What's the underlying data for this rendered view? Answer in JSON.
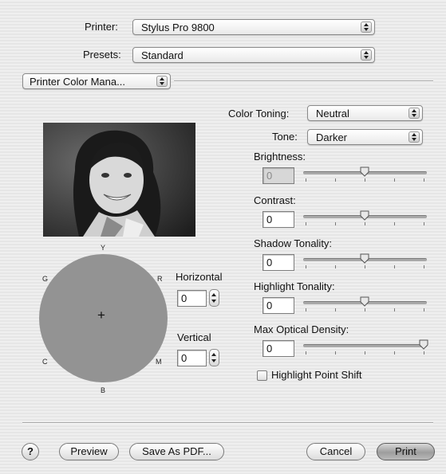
{
  "printer": {
    "label": "Printer:",
    "value": "Stylus Pro 9800"
  },
  "presets": {
    "label": "Presets:",
    "value": "Standard"
  },
  "panel": {
    "value": "Printer Color Mana..."
  },
  "color_toning": {
    "label": "Color Toning:",
    "value": "Neutral"
  },
  "tone": {
    "label": "Tone:",
    "value": "Darker"
  },
  "sliders": [
    {
      "label": "Brightness:",
      "value": "0",
      "disabled": true,
      "level": 0.5
    },
    {
      "label": "Contrast:",
      "value": "0",
      "level": 0.5
    },
    {
      "label": "Shadow Tonality:",
      "value": "0",
      "level": 0.5
    },
    {
      "label": "Highlight Tonality:",
      "value": "0",
      "level": 0.5
    },
    {
      "label": "Max Optical Density:",
      "value": "0",
      "level": 1.0
    }
  ],
  "highlight_point_shift": {
    "label": "Highlight Point Shift",
    "checked": false
  },
  "color_wheel": {
    "letters": {
      "top": "Y",
      "right": "R",
      "left": "G",
      "left_bottom": "C",
      "right_bottom": "M",
      "bottom": "B"
    },
    "center": "+",
    "color": "#939393"
  },
  "horizontal": {
    "label": "Horizontal",
    "value": "0"
  },
  "vertical": {
    "label": "Vertical",
    "value": "0"
  },
  "buttons": {
    "help": "?",
    "preview": "Preview",
    "save_pdf": "Save As PDF...",
    "cancel": "Cancel",
    "print": "Print"
  },
  "icons": {
    "popup_arrows": "updown-arrows-icon",
    "help": "question-icon",
    "photo": "portrait-photo"
  }
}
